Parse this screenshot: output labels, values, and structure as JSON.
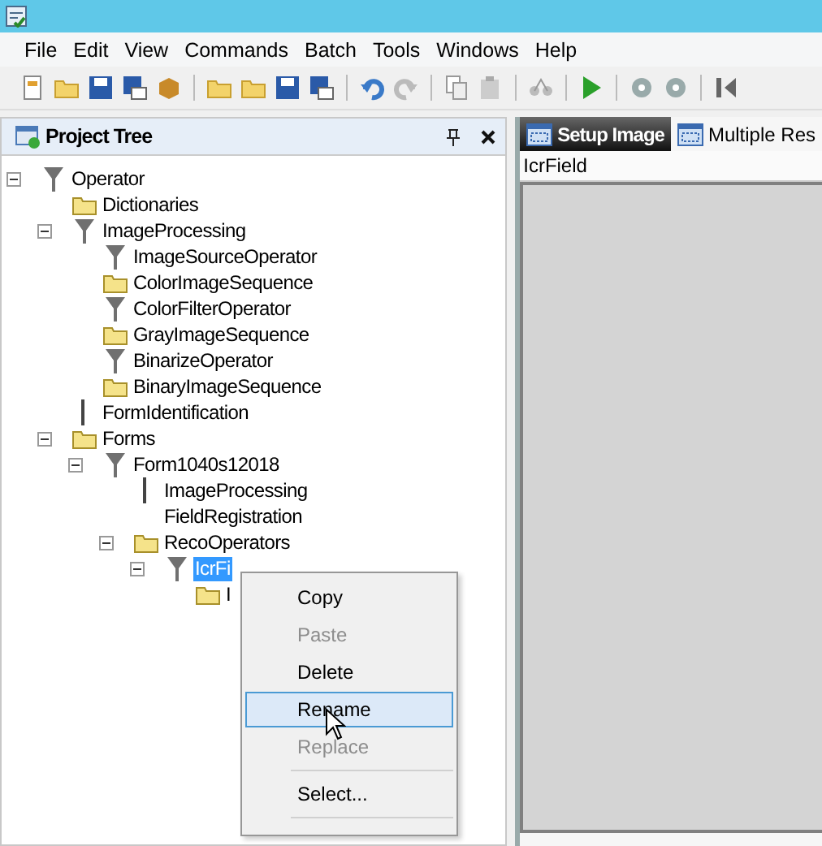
{
  "menu_bar": [
    "File",
    "Edit",
    "View",
    "Commands",
    "Batch",
    "Tools",
    "Windows",
    "Help"
  ],
  "project_tree": {
    "title": "Project Tree",
    "nodes": [
      {
        "label": "Operator",
        "kind": "operator",
        "expanded": true,
        "selected": false,
        "children": [
          {
            "label": "Dictionaries",
            "kind": "folder",
            "selected": false
          },
          {
            "label": "ImageProcessing",
            "kind": "operator",
            "expanded": true,
            "selected": false,
            "children": [
              {
                "label": "ImageSourceOperator",
                "kind": "operator",
                "selected": false
              },
              {
                "label": "ColorImageSequence",
                "kind": "folder",
                "selected": false
              },
              {
                "label": "ColorFilterOperator",
                "kind": "operator",
                "selected": false
              },
              {
                "label": "GrayImageSequence",
                "kind": "folder",
                "selected": false
              },
              {
                "label": "BinarizeOperator",
                "kind": "operator",
                "selected": false
              },
              {
                "label": "BinaryImageSequence",
                "kind": "folder",
                "selected": false
              }
            ]
          },
          {
            "label": "FormIdentification",
            "kind": "link",
            "selected": false
          },
          {
            "label": "Forms",
            "kind": "folder",
            "expanded": true,
            "selected": false,
            "children": [
              {
                "label": "Form1040s12018",
                "kind": "operator",
                "expanded": true,
                "selected": false,
                "children": [
                  {
                    "label": "ImageProcessing",
                    "kind": "link",
                    "selected": false
                  },
                  {
                    "label": "FieldRegistration",
                    "kind": "none",
                    "selected": false
                  },
                  {
                    "label": "RecoOperators",
                    "kind": "folder",
                    "expanded": true,
                    "selected": false,
                    "children": [
                      {
                        "label": "IcrFi",
                        "kind": "operator",
                        "expanded": true,
                        "selected": true,
                        "children": [
                          {
                            "label": "I",
                            "kind": "folder",
                            "selected": false
                          }
                        ]
                      }
                    ]
                  }
                ]
              }
            ]
          }
        ]
      }
    ]
  },
  "document_tabs": [
    {
      "label": "Setup Image",
      "selected": true
    },
    {
      "label": "Multiple Res",
      "selected": false
    }
  ],
  "document_title": "IcrField",
  "context_menu": [
    {
      "label": "Copy",
      "disabled": false,
      "selected": false
    },
    {
      "label": "Paste",
      "disabled": true,
      "selected": false
    },
    {
      "label": "Delete",
      "disabled": false,
      "selected": false
    },
    {
      "label": "Rename",
      "disabled": false,
      "selected": true
    },
    {
      "label": "Replace",
      "disabled": true,
      "selected": false,
      "separator_after": true
    },
    {
      "label": "Select...",
      "disabled": false,
      "selected": false,
      "separator_after": true
    }
  ]
}
